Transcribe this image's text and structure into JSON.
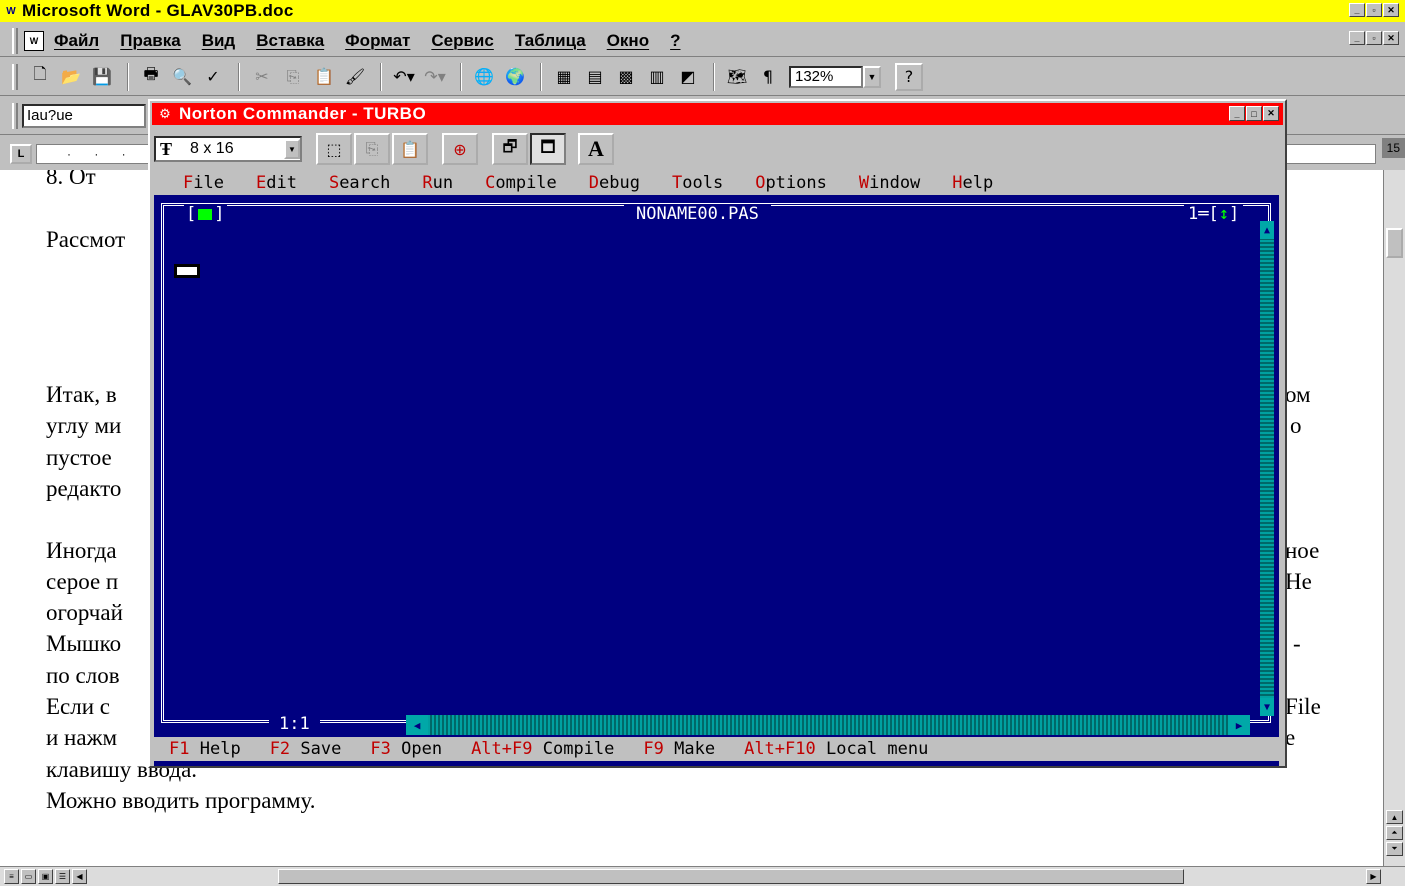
{
  "word": {
    "title": "Microsoft Word - GLAV30PB.doc",
    "logo": "W",
    "menu": [
      "Файл",
      "Правка",
      "Вид",
      "Вставка",
      "Формат",
      "Сервис",
      "Таблица",
      "Окно",
      "?"
    ],
    "zoom": "132%",
    "style_box": "Iau?ue",
    "ruler_left_marker": "L",
    "ruler_text": "· · · 1",
    "ruler_page": "15"
  },
  "document": {
    "lines": [
      {
        "text": "8.    От"
      },
      {
        "text": "Рассмот"
      },
      {
        "text": "Итак, в"
      },
      {
        "text": "углу ми"
      },
      {
        "text": "пустое"
      },
      {
        "text": "редакто"
      },
      {
        "text": "Иногда"
      },
      {
        "text": "серое п"
      },
      {
        "text": "огорчай"
      },
      {
        "text": "Мышко"
      },
      {
        "text": "по слов"
      },
      {
        "text": "Если с"
      },
      {
        "text": "и нажм"
      },
      {
        "text": "клавишу ввода."
      },
      {
        "text": "Можно вводить программу."
      }
    ],
    "right_fragments": [
      "ом",
      "о",
      "ное",
      "Не",
      "-",
      "File",
      "е"
    ]
  },
  "nc": {
    "title": "Norton Commander - TURBO",
    "font_size": "8 x 16",
    "tp_menu": [
      {
        "hot": "F",
        "rest": "ile"
      },
      {
        "hot": "E",
        "rest": "dit"
      },
      {
        "hot": "S",
        "rest": "earch"
      },
      {
        "hot": "R",
        "rest": "un"
      },
      {
        "hot": "C",
        "rest": "ompile"
      },
      {
        "hot": "D",
        "rest": "ebug"
      },
      {
        "hot": "T",
        "rest": "ools"
      },
      {
        "hot": "O",
        "rest": "ptions"
      },
      {
        "hot": "W",
        "rest": "indow"
      },
      {
        "hot": "H",
        "rest": "elp"
      }
    ],
    "editor_filename": "NONAME00.PAS",
    "window_number": "1",
    "cursor_pos": "1:1",
    "status": [
      {
        "key": "F1",
        "label": "Help"
      },
      {
        "key": "F2",
        "label": "Save"
      },
      {
        "key": "F3",
        "label": "Open"
      },
      {
        "key": "Alt+F9",
        "label": "Compile"
      },
      {
        "key": "F9",
        "label": "Make"
      },
      {
        "key": "Alt+F10",
        "label": "Local menu"
      }
    ]
  },
  "colors": {
    "word_title_bg": "#ffff00",
    "nc_title_bg": "#ff0000",
    "tp_background": "#000080",
    "tp_hotkey": "#c00000",
    "tp_scrollbar": "#008080"
  },
  "icons": {
    "word_toolbar": [
      "new-doc-icon",
      "open-folder-icon",
      "save-icon",
      "print-icon",
      "print-preview-icon",
      "spelling-icon",
      "cut-icon",
      "copy-icon",
      "paste-icon",
      "format-painter-icon",
      "undo-icon",
      "redo-icon",
      "web-toolbar-icon",
      "hyperlink-icon",
      "tables-borders-icon",
      "insert-table-icon",
      "insert-excel-icon",
      "columns-icon",
      "drawing-icon",
      "doc-map-icon",
      "show-marks-icon",
      "help-icon"
    ],
    "nc_toolbar": [
      "font-tt-icon",
      "mark-icon",
      "copy-icon",
      "paste-icon",
      "fullscreen-icon",
      "properties-icon",
      "background-icon",
      "font-a-icon"
    ]
  }
}
